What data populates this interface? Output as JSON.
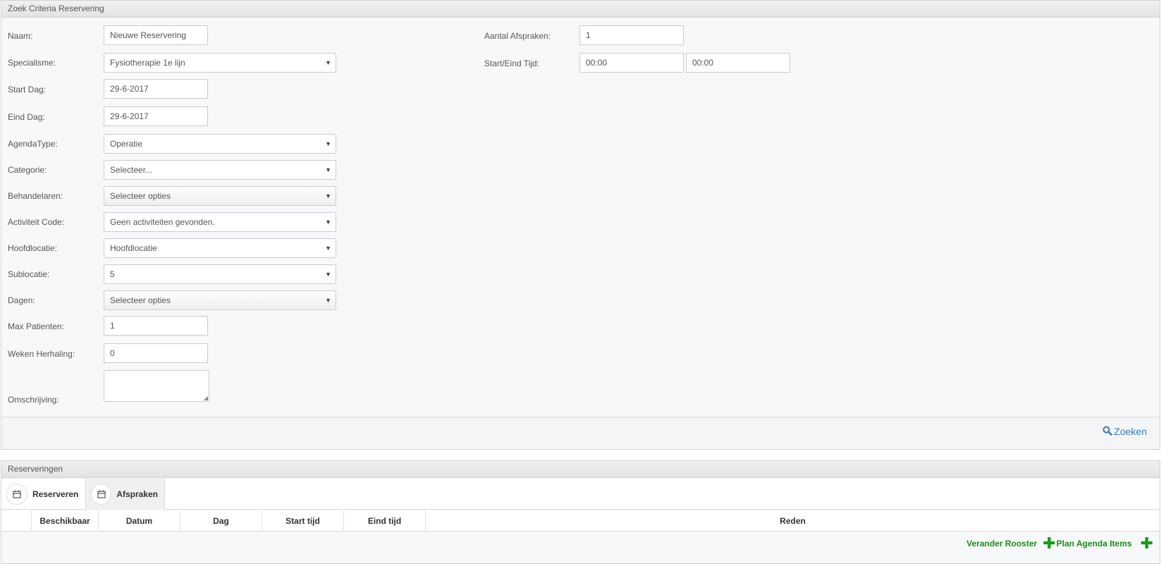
{
  "criteria": {
    "title": "Zoek Criteria Reservering",
    "fields": {
      "naam": {
        "label": "Naam:",
        "value": "Nieuwe Reservering"
      },
      "specialisme": {
        "label": "Specialisme:",
        "value": "Fysiotherapie 1e lijn"
      },
      "start_dag": {
        "label": "Start Dag:",
        "value": "29-6-2017"
      },
      "eind_dag": {
        "label": "Eind Dag:",
        "value": "29-6-2017"
      },
      "agendatype": {
        "label": "AgendaType:",
        "value": "Operatie"
      },
      "categorie": {
        "label": "Categorie:",
        "value": "Selecteer..."
      },
      "behandelaren": {
        "label": "Behandelaren:",
        "value": "Selecteer opties"
      },
      "activiteit": {
        "label": "Activiteit Code:",
        "value": "Geen activiteiten gevonden."
      },
      "hoofdlocatie": {
        "label": "Hoofdlocatie:",
        "value": "Hoofdlocatie"
      },
      "sublocatie": {
        "label": "Sublocatie:",
        "value": "5"
      },
      "dagen": {
        "label": "Dagen:",
        "value": "Selecteer opties"
      },
      "max_patienten": {
        "label": "Max Patienten:",
        "value": "1"
      },
      "weken": {
        "label": "Weken Herhaling:",
        "value": "0"
      },
      "omschrijving": {
        "label": "Omschrijving:",
        "value": ""
      },
      "aantal": {
        "label": "Aantal Afspraken:",
        "value": "1"
      },
      "tijd": {
        "label": "Start/Eind Tijd:",
        "start": "00:00",
        "eind": "00:00"
      }
    },
    "search_label": "Zoeken"
  },
  "results": {
    "title": "Reserveringen",
    "tabs": [
      {
        "label": "Reserveren",
        "icon": "calendar-icon"
      },
      {
        "label": "Afspraken",
        "icon": "calendar-icon"
      }
    ],
    "columns": [
      "Beschikbaar",
      "Datum",
      "Dag",
      "Start tijd",
      "Eind tijd",
      "Reden"
    ],
    "actions": {
      "rooster": "Verander Rooster",
      "plan": "Plan Agenda Items"
    }
  },
  "colors": {
    "accent_link": "#3a7ab8",
    "action_green": "#1a8a1a"
  }
}
